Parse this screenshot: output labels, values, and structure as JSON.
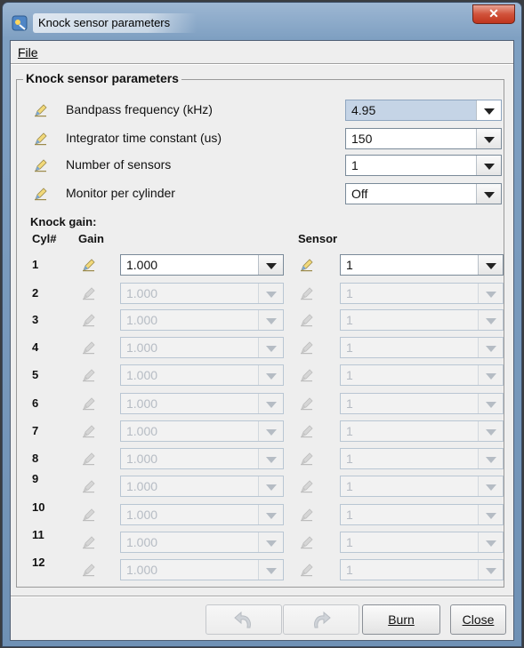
{
  "window": {
    "title": "Knock sensor parameters"
  },
  "menu": {
    "file_label": "File"
  },
  "group": {
    "title": "Knock sensor parameters"
  },
  "params": [
    {
      "label": "Bandpass frequency (kHz)",
      "value": "4.95",
      "selected": true
    },
    {
      "label": "Integrator time constant (us)",
      "value": "150",
      "selected": false
    },
    {
      "label": "Number of sensors",
      "value": "1",
      "selected": false
    },
    {
      "label": "Monitor per cylinder",
      "value": "Off",
      "selected": false
    }
  ],
  "knock_gain": {
    "title": "Knock gain:",
    "headers": {
      "cyl": "Cyl#",
      "gain": "Gain",
      "sensor": "Sensor"
    },
    "rows": [
      {
        "cyl": "1",
        "gain": "1.000",
        "sensor": "1",
        "enabled": true
      },
      {
        "cyl": "2",
        "gain": "1.000",
        "sensor": "1",
        "enabled": false
      },
      {
        "cyl": "3",
        "gain": "1.000",
        "sensor": "1",
        "enabled": false
      },
      {
        "cyl": "4",
        "gain": "1.000",
        "sensor": "1",
        "enabled": false
      },
      {
        "cyl": "5",
        "gain": "1.000",
        "sensor": "1",
        "enabled": false
      },
      {
        "cyl": "6",
        "gain": "1.000",
        "sensor": "1",
        "enabled": false
      },
      {
        "cyl": "7",
        "gain": "1.000",
        "sensor": "1",
        "enabled": false
      },
      {
        "cyl": "8",
        "gain": "1.000",
        "sensor": "1",
        "enabled": false
      },
      {
        "cyl": "9",
        "gain": "1.000",
        "sensor": "1",
        "enabled": false
      },
      {
        "cyl": "10",
        "gain": "1.000",
        "sensor": "1",
        "enabled": false
      },
      {
        "cyl": "11",
        "gain": "1.000",
        "sensor": "1",
        "enabled": false
      },
      {
        "cyl": "12",
        "gain": "1.000",
        "sensor": "1",
        "enabled": false
      }
    ]
  },
  "buttons": {
    "undo_icon": "undo-arrow-icon",
    "redo_icon": "redo-arrow-icon",
    "burn_label": "Burn",
    "close_label": "Close"
  },
  "colors": {
    "selected_field": "#c5d4e6",
    "close_button": "#c9452e"
  }
}
